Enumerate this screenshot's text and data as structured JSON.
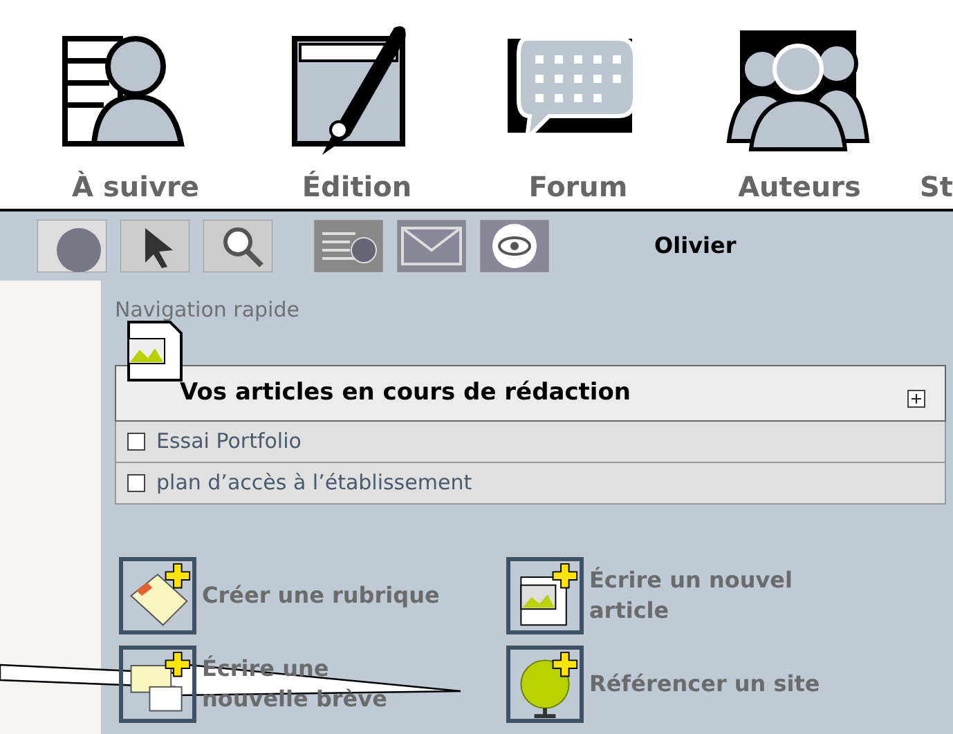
{
  "main_nav": [
    {
      "label": "À suivre",
      "kind": "follow"
    },
    {
      "label": "Édition",
      "kind": "edit"
    },
    {
      "label": "Forum",
      "kind": "forum"
    },
    {
      "label": "Auteurs",
      "kind": "authors"
    },
    {
      "label": "St",
      "kind": "cut"
    }
  ],
  "toolbar": {
    "user": "Olivier"
  },
  "quick_nav": {
    "title": "Navigation rapide"
  },
  "articles_box": {
    "title": "Vos articles en cours de rédaction",
    "items": [
      {
        "title": "Essai Portfolio",
        "checked": false
      },
      {
        "title": "plan d’accès à l’établissement",
        "checked": false
      }
    ]
  },
  "actions": [
    {
      "label": "Créer une rubrique",
      "kind": "section"
    },
    {
      "label": "Écrire un nouvel article",
      "kind": "article"
    },
    {
      "label": "Écrire une nouvelle brève",
      "kind": "brief"
    },
    {
      "label": "Référencer un site",
      "kind": "site"
    }
  ]
}
